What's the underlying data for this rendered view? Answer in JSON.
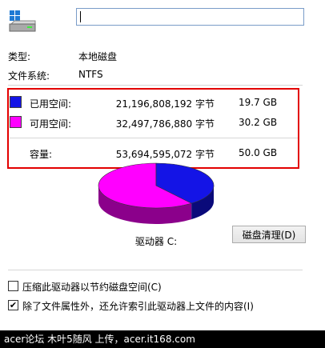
{
  "drive": {
    "name_value": "",
    "type_label": "类型:",
    "type_value": "本地磁盘",
    "fs_label": "文件系统:",
    "fs_value": "NTFS"
  },
  "space": {
    "used": {
      "label": "已用空间:",
      "bytes": "21,196,808,192 字节",
      "size": "19.7 GB",
      "color": "#1414e6"
    },
    "free": {
      "label": "可用空间:",
      "bytes": "32,497,786,880 字节",
      "size": "30.2 GB",
      "color": "#ff00ff"
    },
    "capacity": {
      "label": "容量:",
      "bytes": "53,694,595,072 字节",
      "size": "50.0 GB"
    }
  },
  "pie": {
    "used_fraction": 0.3948,
    "drive_label": "驱动器 C:"
  },
  "buttons": {
    "cleanup": "磁盘清理(D)"
  },
  "options": {
    "compress": {
      "label": "压缩此驱动器以节约磁盘空间(C)",
      "checked": false
    },
    "index": {
      "label": "除了文件属性外，还允许索引此驱动器上文件的内容(I)",
      "checked": true
    }
  },
  "footer": {
    "text": "acer论坛 木叶5随风 上传，acer.it168.com"
  }
}
